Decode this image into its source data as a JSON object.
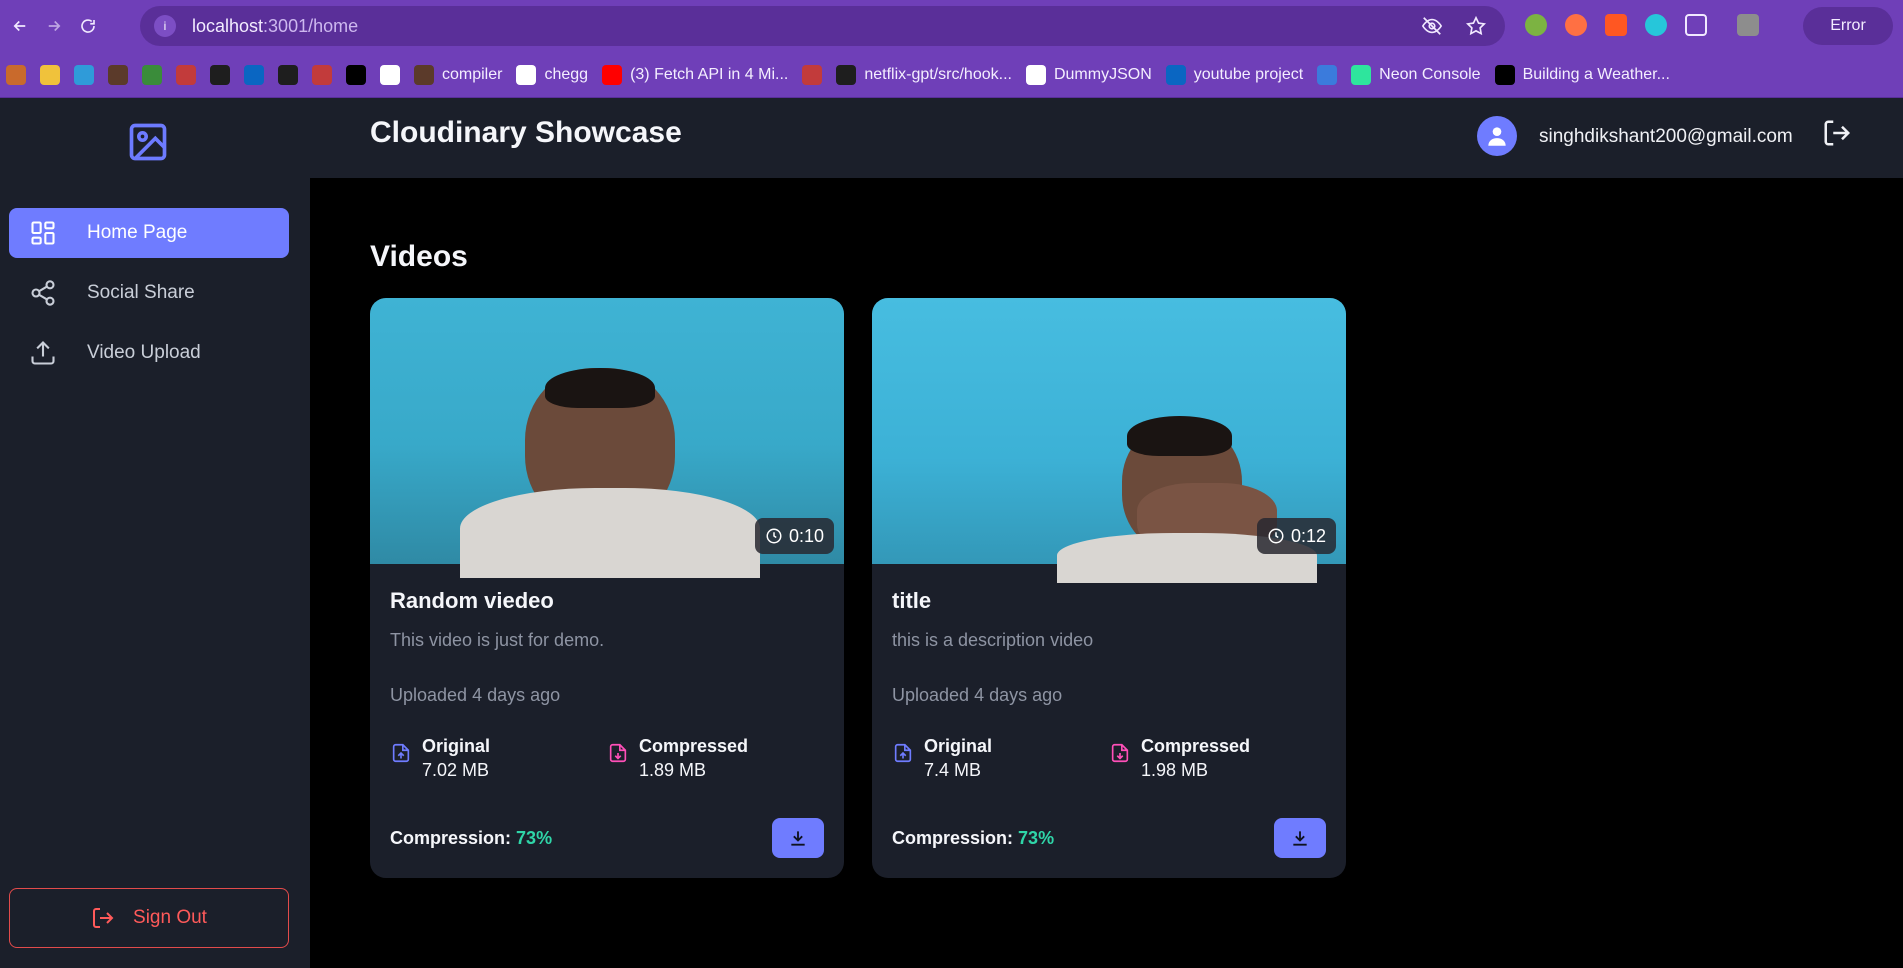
{
  "browser": {
    "url_host": "localhost",
    "url_rest": ":3001/home",
    "error_label": "Error"
  },
  "bookmarks": [
    {
      "label": "",
      "color": "#c96a2c"
    },
    {
      "label": "",
      "color": "#f0c23b"
    },
    {
      "label": "",
      "color": "#2f9bd9"
    },
    {
      "label": "",
      "color": "#5b3a2a"
    },
    {
      "label": "",
      "color": "#3a8c3a"
    },
    {
      "label": "",
      "color": "#c23b3b"
    },
    {
      "label": "",
      "color": "#1e1e1e"
    },
    {
      "label": "",
      "color": "#0a66c2"
    },
    {
      "label": "",
      "color": "#1e1e1e"
    },
    {
      "label": "",
      "color": "#c23b3b"
    },
    {
      "label": "",
      "color": "#000000"
    },
    {
      "label": "",
      "color": "#ffffff"
    },
    {
      "label": "compiler",
      "color": "#5b3a2a"
    },
    {
      "label": "chegg",
      "color": "#ffffff"
    },
    {
      "label": "(3) Fetch API in 4 Mi...",
      "color": "#ff0000"
    },
    {
      "label": "",
      "color": "#c23b3b"
    },
    {
      "label": "netflix-gpt/src/hook...",
      "color": "#1e1e1e"
    },
    {
      "label": "DummyJSON",
      "color": "#ffffff"
    },
    {
      "label": "youtube project",
      "color": "#0a66c2"
    },
    {
      "label": "",
      "color": "#3b7bdc"
    },
    {
      "label": "Neon Console",
      "color": "#2ee59d"
    },
    {
      "label": "Building a Weather...",
      "color": "#000000"
    }
  ],
  "app": {
    "title": "Cloudinary Showcase",
    "user_email": "singhdikshant200@gmail.com",
    "accent_color": "#6f7cff",
    "sidebar": {
      "items": [
        {
          "label": "Home Page",
          "icon": "grid-icon",
          "active": true
        },
        {
          "label": "Social Share",
          "icon": "share-icon",
          "active": false
        },
        {
          "label": "Video Upload",
          "icon": "upload-icon",
          "active": false
        }
      ],
      "sign_out_label": "Sign Out"
    },
    "section_title": "Videos",
    "videos": [
      {
        "duration": "0:10",
        "title": "Random viedeo",
        "description": "This video is just for demo.",
        "uploaded": "Uploaded 4 days ago",
        "original_label": "Original",
        "original_size": "7.02 MB",
        "compressed_label": "Compressed",
        "compressed_size": "1.89 MB",
        "compression_label": "Compression:",
        "compression_value": "73%"
      },
      {
        "duration": "0:12",
        "title": "title",
        "description": "this is a description video",
        "uploaded": "Uploaded 4 days ago",
        "original_label": "Original",
        "original_size": "7.4 MB",
        "compressed_label": "Compressed",
        "compressed_size": "1.98 MB",
        "compression_label": "Compression:",
        "compression_value": "73%"
      }
    ]
  }
}
